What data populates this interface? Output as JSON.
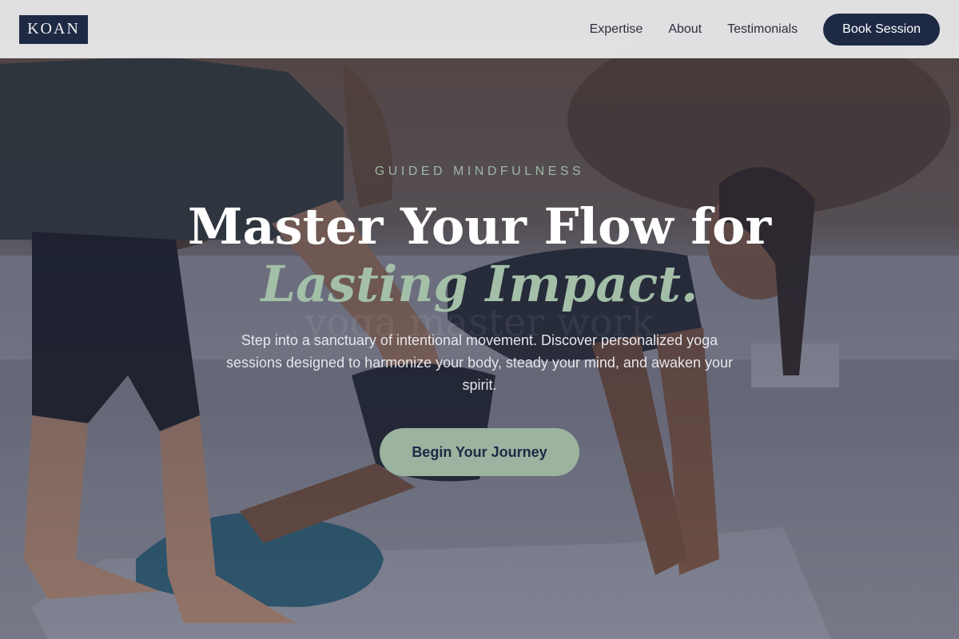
{
  "brand": {
    "logo_text": "KOAN"
  },
  "nav": {
    "links": [
      "Expertise",
      "About",
      "Testimonials"
    ],
    "cta_label": "Book Session"
  },
  "hero": {
    "eyebrow": "GUIDED MINDFULNESS",
    "title_line1": "Master Your Flow for",
    "title_line2": "Lasting Impact.",
    "ghost_text": "yoga master work",
    "subtitle": "Step into a sanctuary of intentional movement. Discover personalized yoga sessions designed to harmonize your body, steady your mind, and awaken your spirit.",
    "cta_label": "Begin Your Journey",
    "background_image": "two-women-yoga-assist-outdoors"
  },
  "colors": {
    "navy": "#1e2a44",
    "sage": "#9bb39f",
    "sage_text": "#a3bfa8",
    "nav_bg": "#ececee"
  }
}
